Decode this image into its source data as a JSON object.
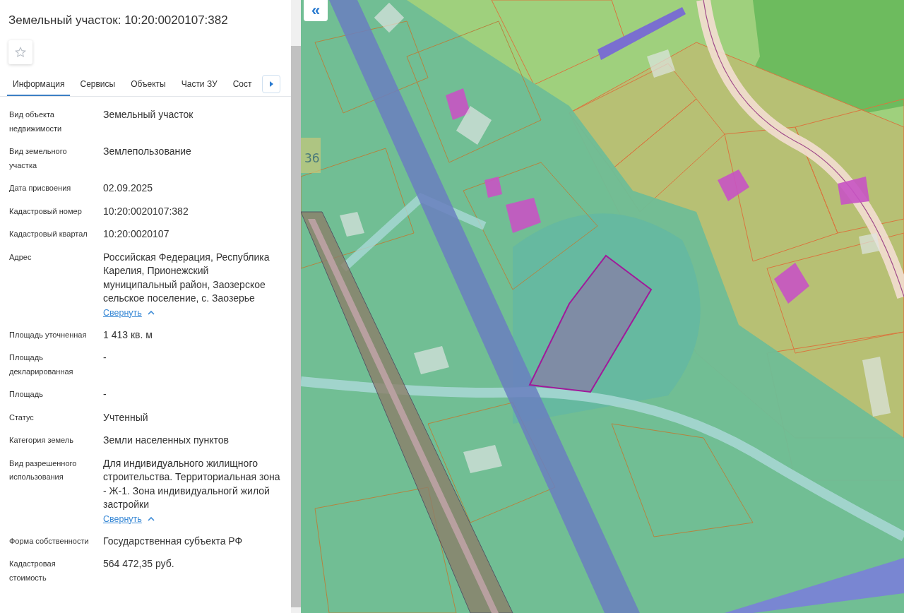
{
  "panel": {
    "title": "Земельный участок: 10:20:0020107:382",
    "tabs": [
      {
        "label": "Информация",
        "selected": true
      },
      {
        "label": "Сервисы",
        "selected": false
      },
      {
        "label": "Объекты",
        "selected": false
      },
      {
        "label": "Части ЗУ",
        "selected": false
      },
      {
        "label": "Сост",
        "selected": false
      }
    ],
    "fields": [
      {
        "label": "Вид объекта недвижимости",
        "value": "Земельный участок"
      },
      {
        "label": "Вид земельного участка",
        "value": "Землепользование"
      },
      {
        "label": "Дата присвоения",
        "value": "02.09.2025"
      },
      {
        "label": "Кадастровый номер",
        "value": "10:20:0020107:382"
      },
      {
        "label": "Кадастровый квартал",
        "value": "10:20:0020107"
      },
      {
        "label": "Адрес",
        "value": "Российская Федерация, Республика Карелия, Прионежский муниципальный район, Заозерское сельское поселение, с. Заозерье",
        "toggle": "Свернуть"
      },
      {
        "label": "Площадь уточненная",
        "value": "1 413 кв. м"
      },
      {
        "label": "Площадь декларированная",
        "value": "-"
      },
      {
        "label": "Площадь",
        "value": "-"
      },
      {
        "label": "Статус",
        "value": "Учтенный"
      },
      {
        "label": "Категория земель",
        "value": "Земли населенных пунктов"
      },
      {
        "label": "Вид разрешенного использования",
        "value": "Для индивидуального жилищного строительства. Территориальная зона - Ж-1. Зона индивидуальногй жилой застройки",
        "toggle": "Свернуть"
      },
      {
        "label": "Форма собственности",
        "value": "Государственная субъекта РФ"
      },
      {
        "label": "Кадастровая стоимость",
        "value": "564 472,35 руб."
      }
    ]
  },
  "map": {
    "collapse_button": "«",
    "parcel_label": "36"
  }
}
